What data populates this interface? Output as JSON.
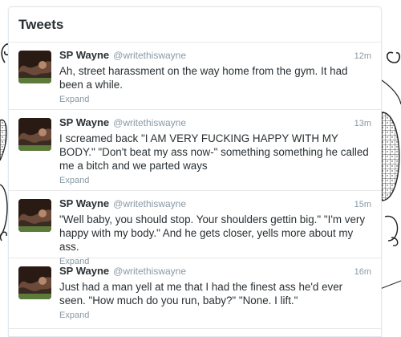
{
  "panel": {
    "title": "Tweets"
  },
  "tweets": [
    {
      "name": "SP Wayne",
      "handle": "@writethiswayne",
      "time": "12m",
      "text": "Ah, street harassment on the way home from the gym. It had been a while.",
      "expand": "Expand"
    },
    {
      "name": "SP Wayne",
      "handle": "@writethiswayne",
      "time": "13m",
      "text": "I screamed back \"I AM VERY FUCKING HAPPY WITH MY BODY.\" \"Don't beat my ass now-\" something something he called me a bitch and we parted ways",
      "expand": "Expand"
    },
    {
      "name": "SP Wayne",
      "handle": "@writethiswayne",
      "time": "15m",
      "text": "\"Well baby, you should stop. Your shoulders gettin big.\" \"I'm very happy with my body.\" And he gets closer, yells more about my ass.",
      "expand": "Expand"
    },
    {
      "name": "SP Wayne",
      "handle": "@writethiswayne",
      "time": "16m",
      "text": "Just had a man yell at me that I had the finest ass he'd ever seen. \"How much do you run, baby?\" \"None. I lift.\"",
      "expand": "Expand"
    }
  ]
}
